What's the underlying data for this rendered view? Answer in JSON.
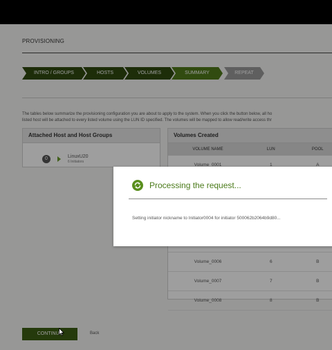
{
  "page": {
    "title": "PROVISIONING"
  },
  "steps": [
    {
      "label": "INTRO / GROUPS",
      "state": "done"
    },
    {
      "label": "HOSTS",
      "state": "done"
    },
    {
      "label": "VOLUMES",
      "state": "done"
    },
    {
      "label": "SUMMARY",
      "state": "current"
    },
    {
      "label": "REPEAT",
      "state": "future"
    }
  ],
  "description": {
    "line1": "The tables below summarize the provisioning configuration you are about to apply to the system. When you click the button below, all ho",
    "line2": "listed host will be attached to every listed volume using the LUN ID specified. The volumes will be mapped to allow read/write access thr"
  },
  "hosts_panel": {
    "title": "Attached Host and Host Groups",
    "host": {
      "badge": "0",
      "name": "LinuxU20",
      "sub": "6 Initiators"
    }
  },
  "volumes_panel": {
    "title": "Volumes Created",
    "columns": [
      "VOLUME NAME",
      "LUN",
      "POOL"
    ],
    "rows": [
      [
        "Volume_0001",
        "1",
        "A"
      ],
      [
        "",
        "",
        ""
      ],
      [
        "",
        "",
        ""
      ],
      [
        "",
        "",
        ""
      ],
      [
        "",
        "",
        ""
      ],
      [
        "Volume_0006",
        "6",
        "B"
      ],
      [
        "Volume_0007",
        "7",
        "B"
      ],
      [
        "Volume_0008",
        "8",
        "B"
      ]
    ]
  },
  "footer": {
    "continue_label": "CONTINUE",
    "back_label": "Back"
  },
  "modal": {
    "title": "Processing the request...",
    "message": "Setting initiator nickname to Initiator0004 for initiator 500062b2064b9d80..."
  },
  "colors": {
    "accent": "#4a7a19",
    "step_done": "#2f4a10",
    "step_current": "#4f7a1a",
    "step_future": "#9a9a9a",
    "button": "#3d5e14"
  },
  "icons": {
    "modal": "refresh-icon",
    "host_arrow": "caret-right-icon",
    "cursor": "pointer-cursor-icon"
  }
}
